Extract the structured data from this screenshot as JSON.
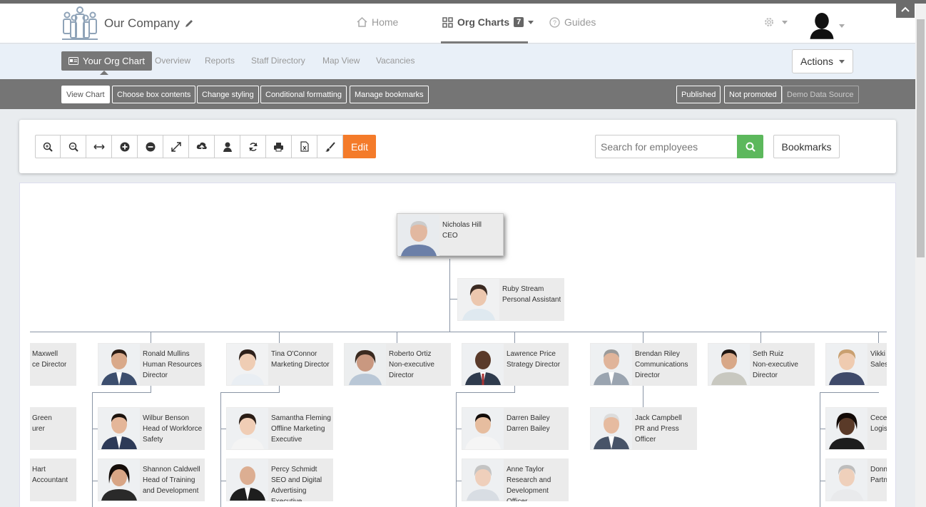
{
  "brand": {
    "name": "Our Company"
  },
  "nav": {
    "home": "Home",
    "org_charts": "Org Charts",
    "org_charts_count": "7",
    "guides": "Guides"
  },
  "subnav": {
    "main_tab": "Your Org Chart",
    "tabs": [
      "Overview",
      "Reports",
      "Staff Directory",
      "Map View",
      "Vacancies"
    ],
    "actions": "Actions"
  },
  "toolbar": {
    "view_chart": "View Chart",
    "choose_box": "Choose box contents",
    "change_styling": "Change styling",
    "conditional": "Conditional formatting",
    "manage_bookmarks": "Manage bookmarks",
    "published": "Published",
    "not_promoted": "Not promoted",
    "demo_source": "Demo Data Source"
  },
  "tools": {
    "icons": [
      "zoom-in-icon",
      "zoom-out-icon",
      "fit-width-icon",
      "expand-all-icon",
      "collapse-all-icon",
      "fullscreen-icon",
      "upload-icon",
      "person-icon",
      "refresh-icon",
      "print-icon",
      "excel-icon",
      "brush-icon"
    ],
    "edit": "Edit",
    "search_placeholder": "Search for employees",
    "bookmarks": "Bookmarks"
  },
  "colors": {
    "accent_orange": "#f47b2a",
    "search_green": "#5cb85c",
    "dark_bar": "#757575"
  },
  "chart": {
    "ceo": {
      "name": "Nicholas Hill",
      "title": "CEO"
    },
    "assistant": {
      "name": "Ruby Stream",
      "title": "Personal Assistant"
    },
    "directors": [
      {
        "name": "Maxwell",
        "title": "ce Director"
      },
      {
        "name": "Ronald Mullins",
        "title": "Human Resources Director"
      },
      {
        "name": "Tina O'Connor",
        "title": "Marketing Director"
      },
      {
        "name": "Roberto Ortiz",
        "title": "Non-executive Director"
      },
      {
        "name": "Lawrence Price",
        "title": "Strategy Director"
      },
      {
        "name": "Brendan Riley",
        "title": "Communications Director"
      },
      {
        "name": "Seth Ruiz",
        "title": "Non-executive Director"
      },
      {
        "name": "Vikki T",
        "title": "Sales"
      }
    ],
    "reports": [
      {
        "name": "Green",
        "title": "urer"
      },
      {
        "name": "Hart",
        "title": "Accountant"
      },
      {
        "name": "Wilbur Benson",
        "title": "Head of Workforce Safety"
      },
      {
        "name": "Shannon Caldwell",
        "title": "Head of Training and Development"
      },
      {
        "name": "Samantha Fleming",
        "title": "Offline Marketing Executive"
      },
      {
        "name": "Percy Schmidt",
        "title": "SEO and Digital Advertising Executive"
      },
      {
        "name": "Darren Bailey",
        "title": "Darren Bailey"
      },
      {
        "name": "Anne Taylor",
        "title": "Research and Development Officer"
      },
      {
        "name": "Jack Campbell",
        "title": "PR and Press Officer"
      },
      {
        "name": "Ceceli",
        "title": "Logist Super"
      },
      {
        "name": "Donna",
        "title": "Partne Super"
      }
    ]
  }
}
